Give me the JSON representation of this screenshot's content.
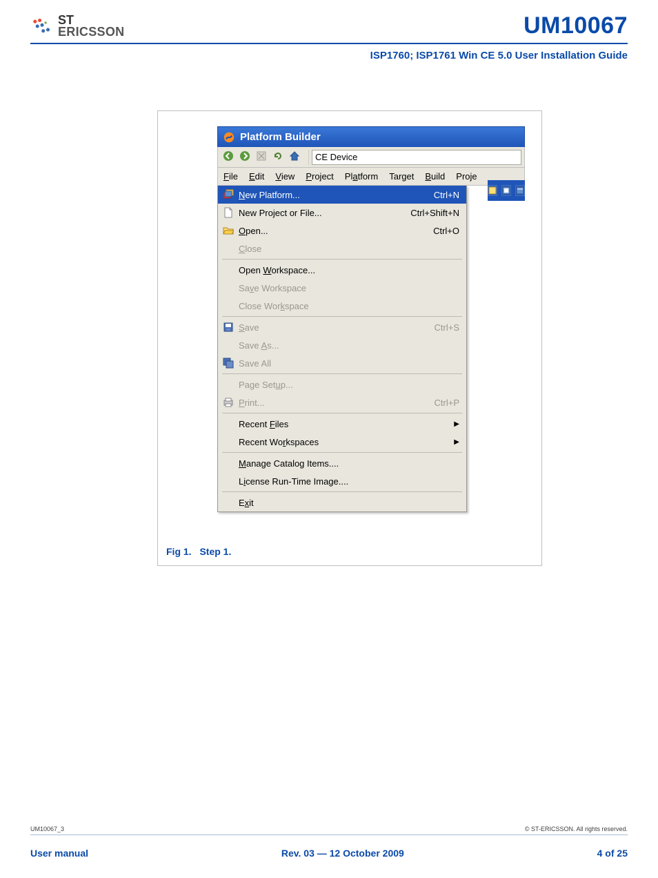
{
  "header": {
    "logo_top": "ST",
    "logo_bottom": "ERICSSON",
    "doc_code": "UM10067",
    "subtitle": "ISP1760; ISP1761 Win CE 5.0 User Installation Guide"
  },
  "screenshot": {
    "title": "Platform Builder",
    "address": "CE Device",
    "menubar": [
      "File",
      "Edit",
      "View",
      "Project",
      "Platform",
      "Target",
      "Build",
      "Proje"
    ],
    "menubar_ul": [
      "F",
      "E",
      "V",
      "P",
      "a",
      "",
      "B",
      ""
    ],
    "toolbar_icons": [
      "back-icon",
      "forward-icon",
      "stop-icon",
      "refresh-icon",
      "home-icon"
    ],
    "groups": [
      {
        "rows": [
          {
            "icon": "new-platform-icon",
            "label": "New Platform...",
            "ul": "N",
            "shortcut": "Ctrl+N",
            "hl": true
          },
          {
            "icon": "new-file-icon",
            "label": "New Project or File...",
            "ul": "",
            "shortcut": "Ctrl+Shift+N"
          },
          {
            "icon": "open-icon",
            "label": "Open...",
            "ul": "O",
            "shortcut": "Ctrl+O"
          },
          {
            "label": "Close",
            "ul": "C",
            "dis": true
          }
        ]
      },
      {
        "rows": [
          {
            "label": "Open Workspace...",
            "ul": "W"
          },
          {
            "label": "Save Workspace",
            "ul": "v",
            "dis": true
          },
          {
            "label": "Close Workspace",
            "ul": "k",
            "dis": true
          }
        ]
      },
      {
        "rows": [
          {
            "icon": "save-icon",
            "label": "Save",
            "ul": "S",
            "shortcut": "Ctrl+S",
            "dis": true
          },
          {
            "label": "Save As...",
            "ul": "A",
            "dis": true
          },
          {
            "icon": "save-all-icon",
            "label": "Save All",
            "dis": true
          }
        ]
      },
      {
        "rows": [
          {
            "label": "Page Setup...",
            "ul": "u",
            "dis": true
          },
          {
            "icon": "print-icon",
            "label": "Print...",
            "ul": "P",
            "shortcut": "Ctrl+P",
            "dis": true
          }
        ]
      },
      {
        "rows": [
          {
            "label": "Recent Files",
            "ul": "F",
            "sub": true
          },
          {
            "label": "Recent Workspaces",
            "ul": "r",
            "sub": true
          }
        ]
      },
      {
        "rows": [
          {
            "label": "Manage Catalog Items....",
            "ul": "M"
          },
          {
            "label": "License Run-Time Image....",
            "ul": "i"
          }
        ]
      },
      {
        "rows": [
          {
            "label": "Exit",
            "ul": "x"
          }
        ]
      }
    ]
  },
  "figure": {
    "caption_a": "Fig 1.",
    "caption_b": "Step 1."
  },
  "footer": {
    "left_top": "UM10067_3",
    "right_top": "© ST-ERICSSON. All rights reserved.",
    "user_manual": "User manual",
    "rev": "Rev. 03 — 12 October 2009",
    "page": "4 of 25"
  }
}
